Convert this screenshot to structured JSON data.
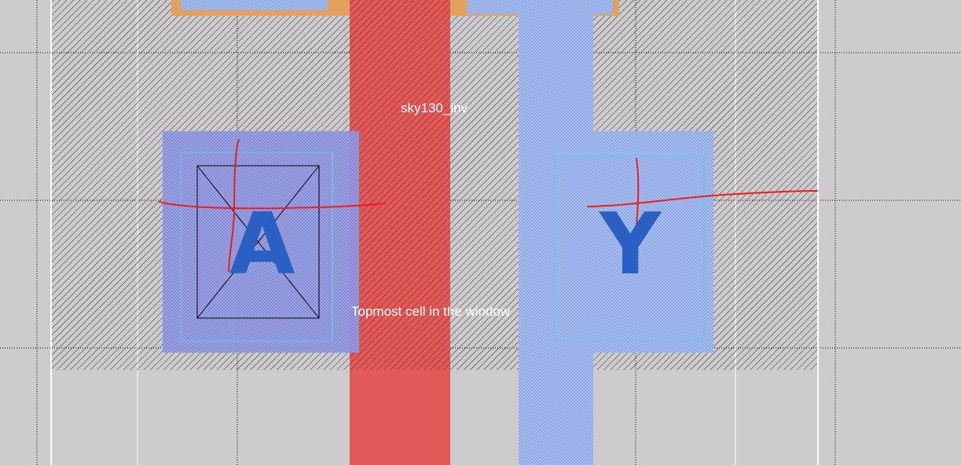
{
  "cell": {
    "name": "sky130_inv",
    "subtitle": "Topmost cell in the window"
  },
  "pins": {
    "input_label": "A",
    "output_label": "Y"
  },
  "colors": {
    "background": "#cdcbce",
    "cell_hatch": "#2a2a2a",
    "poly": "#e05a58",
    "metal1": "#a9c0ee",
    "local_interconnect": "#9ba2e3",
    "pin_text": "#2a5fc4",
    "annotation": "#ee1c1c",
    "contact_outline": "#5fd0f0",
    "diffusion": "#e2a15c"
  }
}
